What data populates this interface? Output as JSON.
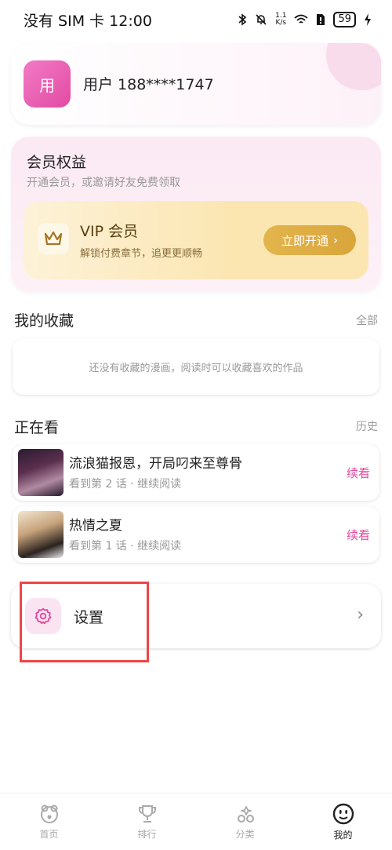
{
  "status": {
    "carrier_time": "没有 SIM 卡 12:00",
    "net_speed_top": "1.1",
    "net_speed_bottom": "K/s",
    "battery": "59"
  },
  "user": {
    "avatar_text": "用",
    "name": "用户 188****1747"
  },
  "vip_section": {
    "title": "会员权益",
    "subtitle": "开通会员，或邀请好友免费领取",
    "card_title": "VIP 会员",
    "card_desc": "解锁付费章节，追更更顺畅",
    "open_label": "立即开通",
    "open_chevron": "›"
  },
  "favorites": {
    "title": "我的收藏",
    "link": "全部",
    "empty_text": "还没有收藏的漫画，阅读时可以收藏喜欢的作品"
  },
  "reading": {
    "title": "正在看",
    "link": "历史",
    "items": [
      {
        "title": "流浪猫报恩，开局叼来至尊骨",
        "progress": "看到第 2 话 · 继续阅读",
        "action": "续看"
      },
      {
        "title": "热情之夏",
        "progress": "看到第 1 话 · 继续阅读",
        "action": "续看"
      }
    ]
  },
  "settings": {
    "label": "设置",
    "chevron": "›"
  },
  "tabs": [
    {
      "label": "首页",
      "icon": "home-icon"
    },
    {
      "label": "排行",
      "icon": "trophy-icon"
    },
    {
      "label": "分类",
      "icon": "category-icon"
    },
    {
      "label": "我的",
      "icon": "profile-icon"
    }
  ],
  "colors": {
    "accent_pink": "#e0489c",
    "vip_gold": "#d9a53b",
    "highlight_red": "#f04545"
  }
}
